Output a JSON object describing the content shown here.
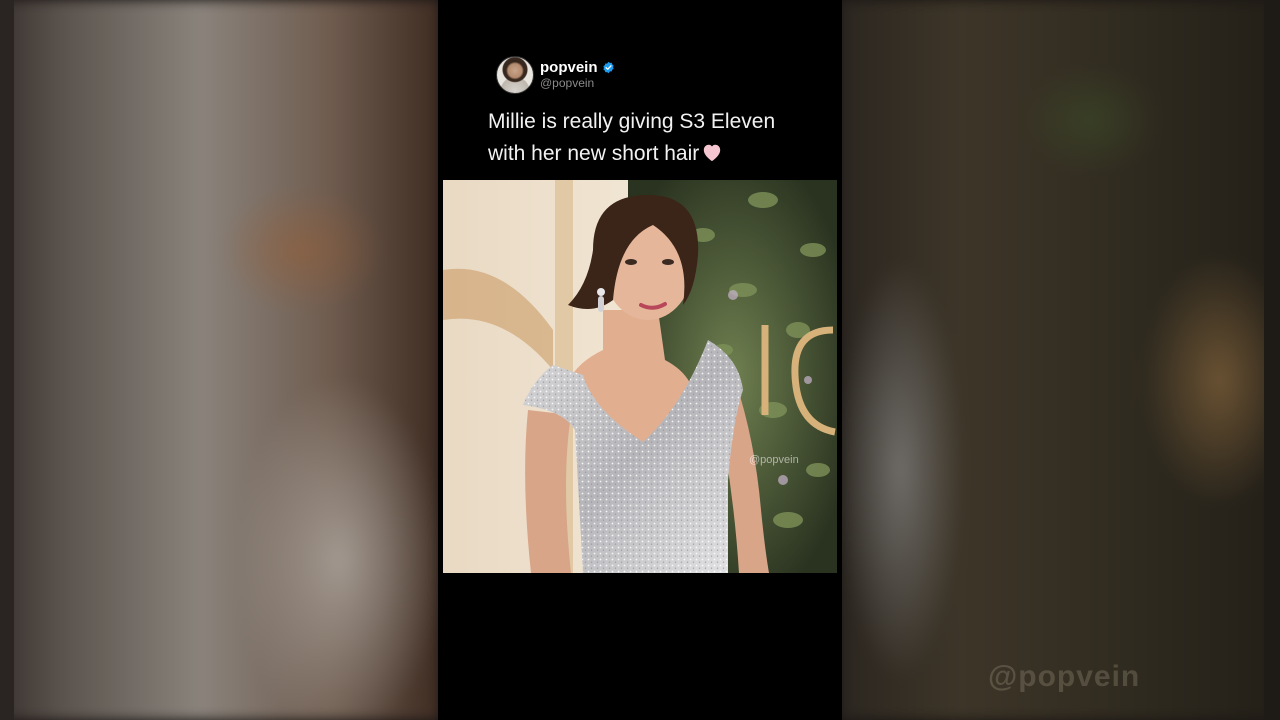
{
  "post": {
    "display_name": "popvein",
    "handle": "@popvein",
    "verified": true,
    "text_line1": "Millie is really giving S3 Eleven",
    "text_line2": "with her new short hair",
    "photo_watermark": "@popvein"
  },
  "background": {
    "watermark": "@popvein"
  },
  "colors": {
    "panel": "#000000",
    "verified": "#1d9bf0",
    "heart": "#f6c6d0",
    "text": "#f2f2f2",
    "handle": "#8b8b8b"
  },
  "icons": {
    "verified": "verified-badge-icon",
    "heart": "pink-heart-icon"
  }
}
